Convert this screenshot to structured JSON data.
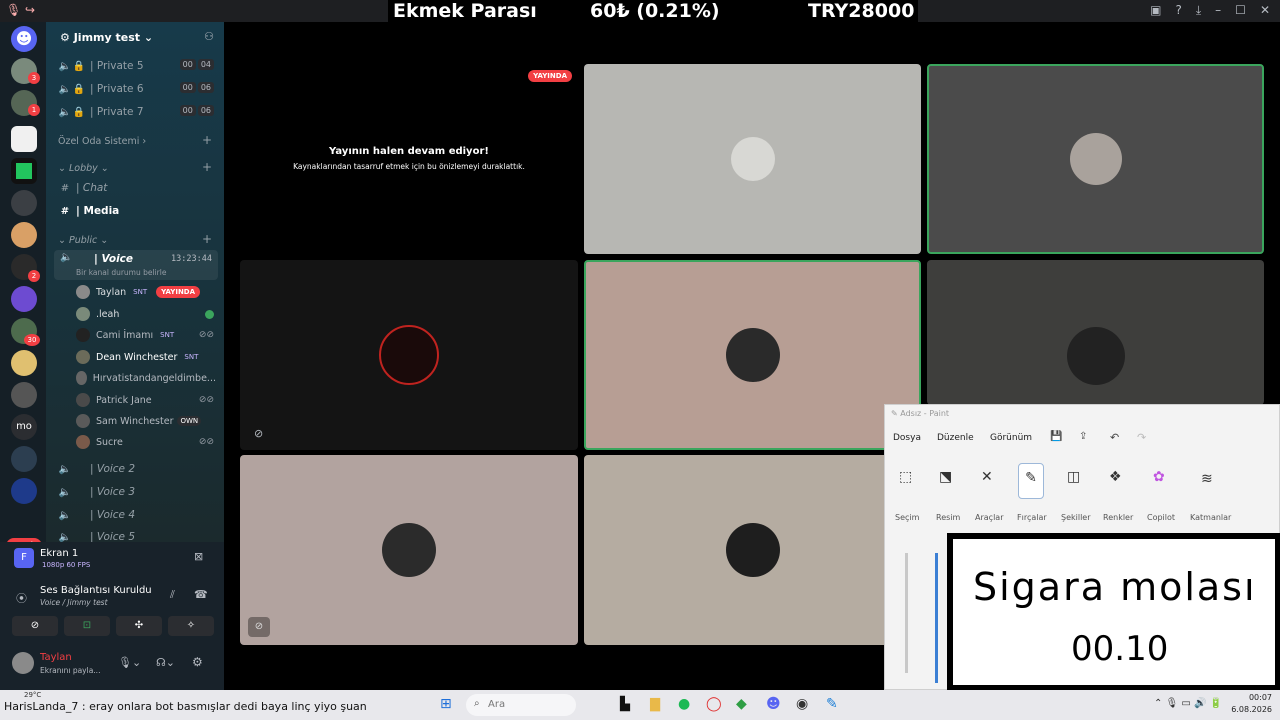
{
  "ticker": {
    "label": "Ekmek Parası",
    "value": "60₺ (0.21%)",
    "total": "TRY28000"
  },
  "sidebar": {
    "server_name": "Jimmy test",
    "private_channels": [
      {
        "label": "| Private 5",
        "count_a": "00",
        "count_b": "04"
      },
      {
        "label": "| Private 6",
        "count_a": "00",
        "count_b": "06"
      },
      {
        "label": "| Private 7",
        "count_a": "00",
        "count_b": "06"
      }
    ],
    "category_ozel": "Özel Oda Sistemi",
    "category_lobby": "Lobby",
    "chat_label": "| Chat",
    "media_label": "| Media",
    "category_public": "Public",
    "voice_label": "| Voice",
    "voice_time": "13:23:44",
    "voice_status": "Bir kanal durumu belirle",
    "members": [
      {
        "name": "Taylan",
        "tag": "SNT",
        "extra": "YAYINDA"
      },
      {
        "name": ".leah",
        "tag": "",
        "extra": ""
      },
      {
        "name": "Cami İmamı",
        "tag": "SNT",
        "extra": ""
      },
      {
        "name": "Dean Winchester",
        "tag": "SNT",
        "extra": ""
      },
      {
        "name": "Hırvatistandangeldimbe...",
        "tag": "",
        "extra": ""
      },
      {
        "name": "Patrick Jane",
        "tag": "",
        "extra": ""
      },
      {
        "name": "Sam Winchester",
        "tag": "OWN",
        "extra": ""
      },
      {
        "name": "Sucre",
        "tag": "",
        "extra": ""
      }
    ],
    "other_voice": [
      "| Voice 2",
      "| Voice 3",
      "| Voice 4",
      "| Voice 5"
    ]
  },
  "rail": {
    "yeni": "YENİ",
    "badges": [
      "3",
      "1",
      "2",
      "30"
    ],
    "mo": "mo"
  },
  "panel": {
    "screen_title": "Ekran 1",
    "screen_quality": "1080p 60 FPS",
    "connection": "Ses Bağlantısı Kuruldu",
    "connection_sub": "Voice / Jimmy test",
    "user_name": "Taylan",
    "user_status": "Ekranını payla..."
  },
  "stage": {
    "live_badge": "YAYINDA",
    "paused_title": "Yayının halen devam ediyor!",
    "paused_sub": "Kaynaklarından tasarruf etmek için bu önizlemeyi duraklattık."
  },
  "paint": {
    "title": "Adsız - Paint",
    "menu": [
      "Dosya",
      "Düzenle",
      "Görünüm"
    ],
    "tools": [
      "Seçim",
      "Resim",
      "Araçlar",
      "Fırçalar",
      "Şekiller",
      "Renkler",
      "Copilot",
      "Katmanlar"
    ],
    "handwriting_line1": "Sigara molası",
    "handwriting_line2": "00.10"
  },
  "taskbar": {
    "weather": "29°C",
    "subtitle": "HarisLanda_7 : eray onlara bot basmışlar dedi baya linç yiyo şuan",
    "search": "Ara",
    "time": "00:07",
    "date": "6.08.2026"
  },
  "colors": {
    "live_red": "#f23f43",
    "speaking_green": "#3ba55d"
  }
}
